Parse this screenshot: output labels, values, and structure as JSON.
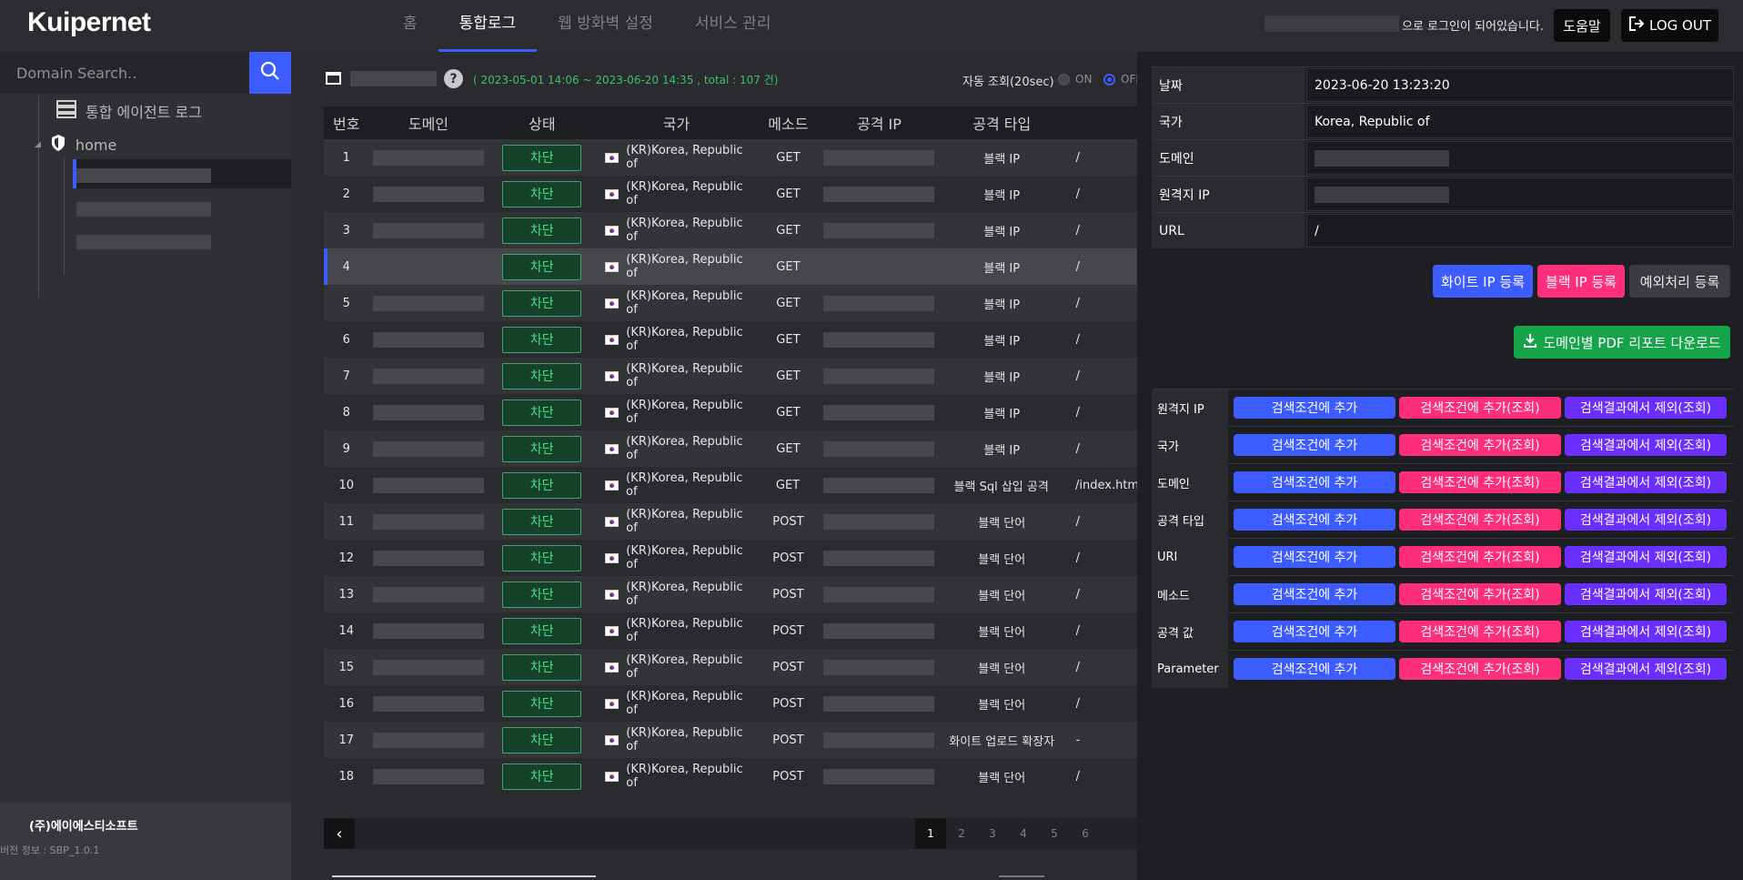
{
  "app": {
    "logo": "Kuipernet"
  },
  "topnav": {
    "tabs": [
      {
        "label": "홈"
      },
      {
        "label": "통합로그"
      },
      {
        "label": "웹 방화벽 설정"
      },
      {
        "label": "서비스 관리"
      }
    ]
  },
  "user": {
    "login_text": "으로 로그인이 되어있습니다.",
    "help_label": "도움말",
    "logout_label": "LOG OUT"
  },
  "sidebar": {
    "search_placeholder": "Domain Search..",
    "items": [
      {
        "label": "통합 에이전트 로그"
      },
      {
        "label": "home"
      }
    ],
    "company": "(주)에이에스티소프트",
    "version": "버전 정보 : SBP_1.0.1"
  },
  "filter": {
    "date_range": "( 2023-05-01 14:06 ~ 2023-06-20 14:35 , total : 107 건)",
    "auto_label": "자동 조회(20sec)",
    "on_label": "ON",
    "off_label": "OFF"
  },
  "table": {
    "columns": [
      "번호",
      "도메인",
      "상태",
      "국가",
      "메소드",
      "공격 IP",
      "공격 타입"
    ],
    "rows": [
      {
        "no": "1",
        "status": "차단",
        "country": "(KR)Korea, Republic of",
        "method": "GET",
        "type": "블랙 IP",
        "url": "/"
      },
      {
        "no": "2",
        "status": "차단",
        "country": "(KR)Korea, Republic of",
        "method": "GET",
        "type": "블랙 IP",
        "url": "/"
      },
      {
        "no": "3",
        "status": "차단",
        "country": "(KR)Korea, Republic of",
        "method": "GET",
        "type": "블랙 IP",
        "url": "/"
      },
      {
        "no": "4",
        "status": "차단",
        "country": "(KR)Korea, Republic of",
        "method": "GET",
        "type": "블랙 IP",
        "url": "/"
      },
      {
        "no": "5",
        "status": "차단",
        "country": "(KR)Korea, Republic of",
        "method": "GET",
        "type": "블랙 IP",
        "url": "/"
      },
      {
        "no": "6",
        "status": "차단",
        "country": "(KR)Korea, Republic of",
        "method": "GET",
        "type": "블랙 IP",
        "url": "/"
      },
      {
        "no": "7",
        "status": "차단",
        "country": "(KR)Korea, Republic of",
        "method": "GET",
        "type": "블랙 IP",
        "url": "/"
      },
      {
        "no": "8",
        "status": "차단",
        "country": "(KR)Korea, Republic of",
        "method": "GET",
        "type": "블랙 IP",
        "url": "/"
      },
      {
        "no": "9",
        "status": "차단",
        "country": "(KR)Korea, Republic of",
        "method": "GET",
        "type": "블랙 IP",
        "url": "/"
      },
      {
        "no": "10",
        "status": "차단",
        "country": "(KR)Korea, Republic of",
        "method": "GET",
        "type": "블랙 Sql 삽입 공격",
        "url": "/index.html"
      },
      {
        "no": "11",
        "status": "차단",
        "country": "(KR)Korea, Republic of",
        "method": "POST",
        "type": "블랙 단어",
        "url": "/"
      },
      {
        "no": "12",
        "status": "차단",
        "country": "(KR)Korea, Republic of",
        "method": "POST",
        "type": "블랙 단어",
        "url": "/"
      },
      {
        "no": "13",
        "status": "차단",
        "country": "(KR)Korea, Republic of",
        "method": "POST",
        "type": "블랙 단어",
        "url": "/"
      },
      {
        "no": "14",
        "status": "차단",
        "country": "(KR)Korea, Republic of",
        "method": "POST",
        "type": "블랙 단어",
        "url": "/"
      },
      {
        "no": "15",
        "status": "차단",
        "country": "(KR)Korea, Republic of",
        "method": "POST",
        "type": "블랙 단어",
        "url": "/"
      },
      {
        "no": "16",
        "status": "차단",
        "country": "(KR)Korea, Republic of",
        "method": "POST",
        "type": "블랙 단어",
        "url": "/"
      },
      {
        "no": "17",
        "status": "차단",
        "country": "(KR)Korea, Republic of",
        "method": "POST",
        "type": "화이트 업로드 확장자",
        "url": "-"
      },
      {
        "no": "18",
        "status": "차단",
        "country": "(KR)Korea, Republic of",
        "method": "POST",
        "type": "블랙 단어",
        "url": "/"
      }
    ]
  },
  "pagination": {
    "pages": [
      "1",
      "2",
      "3",
      "4",
      "5",
      "6"
    ]
  },
  "detail": {
    "rows": [
      {
        "label": "날짜",
        "value": "2023-06-20 13:23:20"
      },
      {
        "label": "국가",
        "value": "Korea, Republic of"
      },
      {
        "label": "도메인",
        "value": ""
      },
      {
        "label": "원격지 IP",
        "value": ""
      },
      {
        "label": "URL",
        "value": "/"
      }
    ],
    "white_ip_btn": "화이트 IP 등록",
    "black_ip_btn": "블랙 IP 등록",
    "exception_btn": "예외처리 등록",
    "pdf_btn": "도메인별 PDF 리포트 다운로드",
    "conditions": [
      {
        "label": "원격지 IP"
      },
      {
        "label": "국가"
      },
      {
        "label": "도메인"
      },
      {
        "label": "공격 타입"
      },
      {
        "label": "URI"
      },
      {
        "label": "메소드"
      },
      {
        "label": "공격 값"
      },
      {
        "label": "Parameter"
      }
    ],
    "add_label": "검색조건에 추가",
    "add_query_label": "검색조건에 추가(조회)",
    "exclude_label": "검색결과에서 제외(조회)"
  },
  "colors": {
    "accent": "#3d5cff",
    "pink": "#ff2e7a",
    "purple": "#6a2eff",
    "green": "#40e288",
    "pdf_green": "#16a34a"
  }
}
